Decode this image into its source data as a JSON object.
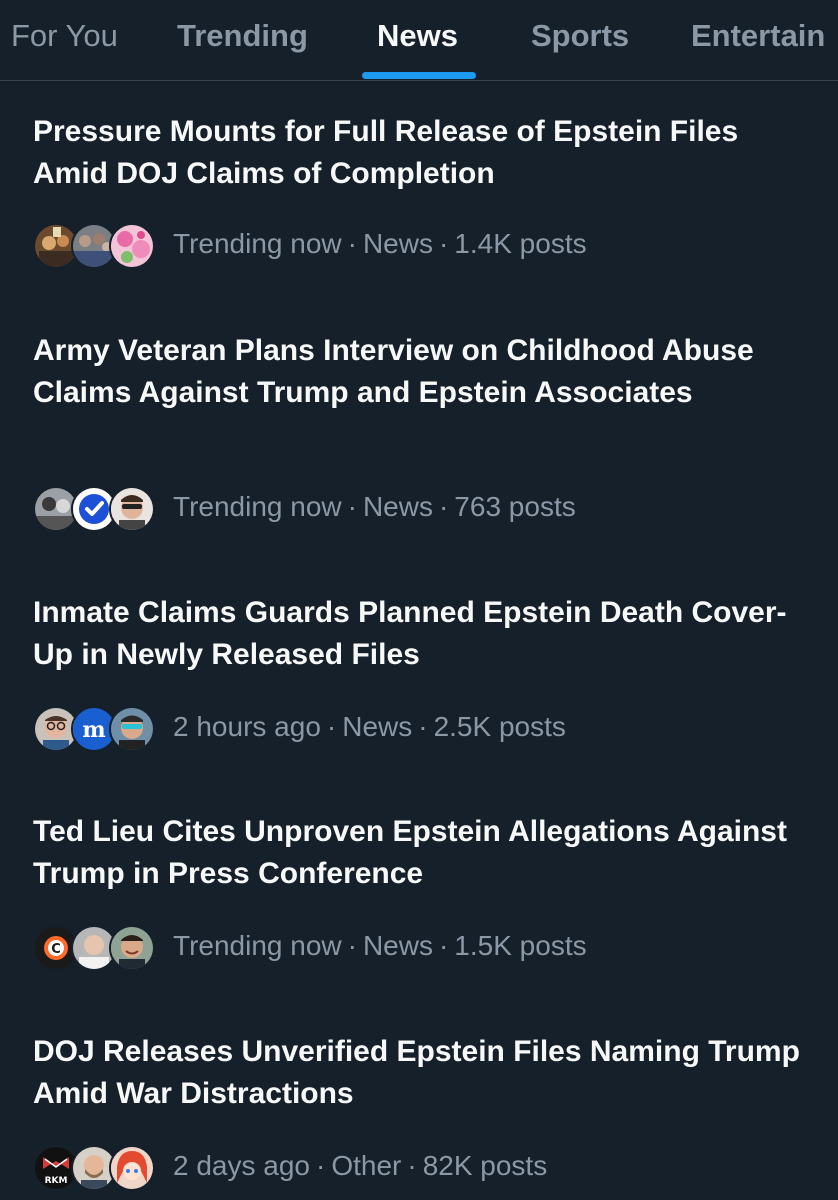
{
  "tabs": [
    {
      "label": "For You",
      "active": false
    },
    {
      "label": "Trending",
      "active": false
    },
    {
      "label": "News",
      "active": true
    },
    {
      "label": "Sports",
      "active": false
    },
    {
      "label": "Entertain",
      "active": false
    }
  ],
  "colors": {
    "background": "#15202b",
    "text_primary": "#f7f9f9",
    "text_secondary": "#8b98a5",
    "accent": "#1d9bf0",
    "divider": "#38444d"
  },
  "feed": [
    {
      "headline": "Pressure Mounts for Full Release of Epstein Files Amid DOJ Claims of Completion",
      "time": "Trending now",
      "category": "News",
      "posts": "1.4K posts",
      "avatars": [
        "group-photo-avatar",
        "crowd-photo-avatar",
        "pink-flowers-avatar"
      ]
    },
    {
      "headline": "Army Veteran Plans Interview on Childhood Abuse Claims Against Trump and Epstein Associates",
      "time": "Trending now",
      "category": "News",
      "posts": "763 posts",
      "avatars": [
        "group-photo-avatar",
        "verified-badge-avatar",
        "person-sunglasses-avatar"
      ]
    },
    {
      "headline": "Inmate Claims Guards Planned Epstein Death Cover-Up in Newly Released Files",
      "time": "2 hours ago",
      "category": "News",
      "posts": "2.5K posts",
      "avatars": [
        "person-glasses-avatar",
        "m-logo-avatar",
        "person-sunglasses-avatar"
      ]
    },
    {
      "headline": "Ted Lieu Cites Unproven Epstein Allegations Against Trump in Press Conference",
      "time": "Trending now",
      "category": "News",
      "posts": "1.5K posts",
      "avatars": [
        "c-logo-avatar",
        "person-photo-avatar",
        "smiling-man-avatar"
      ]
    },
    {
      "headline": "DOJ Releases Unverified Epstein Files Naming Trump Amid War Distractions",
      "time": "2 days ago",
      "category": "Other",
      "posts": "82K posts",
      "avatars": [
        "rkm-logo-avatar",
        "bearded-man-avatar",
        "anime-character-avatar"
      ],
      "rkm_label": "RKM"
    }
  ]
}
